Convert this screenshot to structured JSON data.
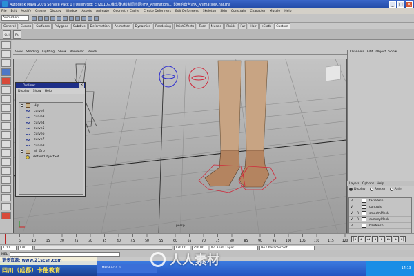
{
  "window": {
    "title": "Autodesk Maya 2009 Service Pack 1 | Unlimited: E:\\2010三维比赛\\(绘制调线网)\\HK_Animation\\... 影用的角色\\HK_AnimationChar.ma"
  },
  "menubar": [
    "File",
    "Edit",
    "Modify",
    "Create",
    "Display",
    "Window",
    "Assets",
    "Animate",
    "Geometry Cache",
    "Create Deformers",
    "Edit Deformers",
    "Skeleton",
    "Skin",
    "Constrain",
    "Character",
    "Muscle",
    "Help"
  ],
  "status_line": {
    "mode": "Animation"
  },
  "shelf_tabs": [
    "General",
    "Curves",
    "Surfaces",
    "Polygons",
    "Subdivs",
    "Deformation",
    "Animation",
    "Dynamics",
    "Rendering",
    "PaintEffects",
    "Toon",
    "Muscle",
    "Fluids",
    "Fur",
    "Hair",
    "nCloth",
    "Custom"
  ],
  "shelf_active_tab": "Custom",
  "shelf_buttons": [
    "Ctrl",
    "Fld"
  ],
  "viewport": {
    "menu": [
      "View",
      "Shading",
      "Lighting",
      "Show",
      "Renderer",
      "Panels"
    ],
    "camera_label": "persp"
  },
  "outliner": {
    "title": "Outliner",
    "menu": [
      "Display",
      "Show",
      "Help"
    ],
    "items": [
      {
        "name": "Hip",
        "type": "group"
      },
      {
        "name": "curve2",
        "type": "curve"
      },
      {
        "name": "curve3",
        "type": "curve"
      },
      {
        "name": "curve4",
        "type": "curve"
      },
      {
        "name": "curve5",
        "type": "curve"
      },
      {
        "name": "curve6",
        "type": "curve"
      },
      {
        "name": "curve7",
        "type": "curve"
      },
      {
        "name": "curve8",
        "type": "curve"
      },
      {
        "name": "all_Grp",
        "type": "group"
      },
      {
        "name": "defaultObjectSet",
        "type": "set"
      }
    ]
  },
  "channel_box": {
    "menu": [
      "Channels",
      "Edit",
      "Object",
      "Show"
    ]
  },
  "layer_editor": {
    "menu": [
      "Layers",
      "Options",
      "Help"
    ],
    "radio": [
      "Display",
      "Render",
      "Anim"
    ],
    "layers": [
      {
        "v": "V",
        "r": "",
        "name": "facialWin"
      },
      {
        "v": "V",
        "r": "",
        "name": "controls"
      },
      {
        "v": "V",
        "r": "R",
        "name": "smoothMesh"
      },
      {
        "v": "V",
        "r": "R",
        "name": "dummyMesh"
      },
      {
        "v": "V",
        "r": "",
        "name": "hairMesh"
      }
    ]
  },
  "timeline": {
    "ticks": [
      "1",
      "5",
      "10",
      "15",
      "20",
      "25",
      "30",
      "35",
      "40",
      "45",
      "50",
      "55",
      "60",
      "65",
      "70",
      "75",
      "80",
      "85",
      "90",
      "95",
      "100",
      "105",
      "110",
      "115",
      "120"
    ],
    "current_frame": "1.00"
  },
  "range": {
    "start": "1.00",
    "inner_start": "1.00",
    "inner_end": "120.00",
    "end": "250.00",
    "anim_layer": "No Anim Layer",
    "character_set": "No Character Set"
  },
  "command_line": {
    "label": "MEL"
  },
  "taskbar": {
    "start_label": "开始",
    "task_label": "TMPGEnc 4.0",
    "clock": "14:13"
  },
  "watermark": {
    "line1": "更多资源: www.21scsn.com",
    "line2": "四川（成都）卡能教育",
    "center": "人人素材"
  }
}
